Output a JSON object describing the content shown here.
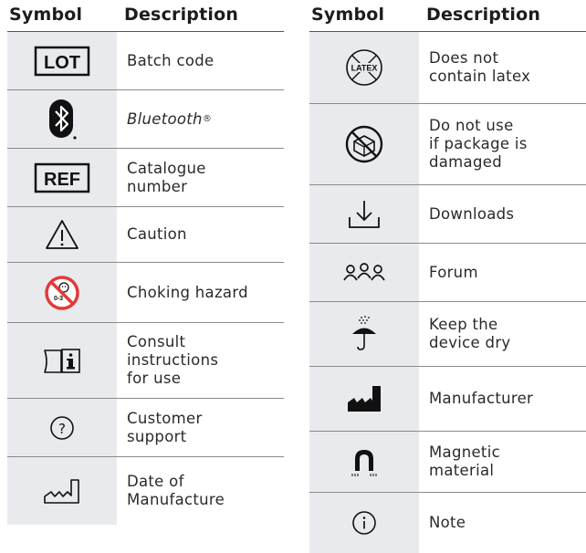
{
  "headers": {
    "symbol": "Symbol",
    "description": "Description"
  },
  "left_rows": [
    {
      "icon": "lot-icon",
      "text": "Batch code",
      "icon_text": "LOT"
    },
    {
      "icon": "bluetooth-icon",
      "text": "Bluetooth",
      "sup": "®",
      "italic": true
    },
    {
      "icon": "ref-icon",
      "text": "Catalogue\nnumber",
      "icon_text": "REF"
    },
    {
      "icon": "caution-icon",
      "text": "Caution"
    },
    {
      "icon": "choking-hazard-icon",
      "text": "Choking hazard",
      "icon_text": "0-3"
    },
    {
      "icon": "consult-instructions-icon",
      "text": "Consult\ninstructions\nfor use"
    },
    {
      "icon": "customer-support-icon",
      "text": "Customer\nsupport"
    },
    {
      "icon": "date-of-manufacture-icon",
      "text": "Date of\nManufacture"
    }
  ],
  "right_rows": [
    {
      "icon": "latex-free-icon",
      "text": "Does not\ncontain latex",
      "icon_text": "LATEX"
    },
    {
      "icon": "damaged-package-icon",
      "text": "Do not use\nif package is\ndamaged"
    },
    {
      "icon": "download-icon",
      "text": "Downloads"
    },
    {
      "icon": "forum-icon",
      "text": "Forum"
    },
    {
      "icon": "keep-dry-icon",
      "text": "Keep the\ndevice dry"
    },
    {
      "icon": "manufacturer-icon",
      "text": "Manufacturer"
    },
    {
      "icon": "magnetic-material-icon",
      "text": "Magnetic\nmaterial"
    },
    {
      "icon": "note-icon",
      "text": "Note"
    }
  ],
  "colors": {
    "symbol_cell_bg": "#e9eaed",
    "prohibition_red": "#e23a3a",
    "rule": "#8a8a8a"
  }
}
